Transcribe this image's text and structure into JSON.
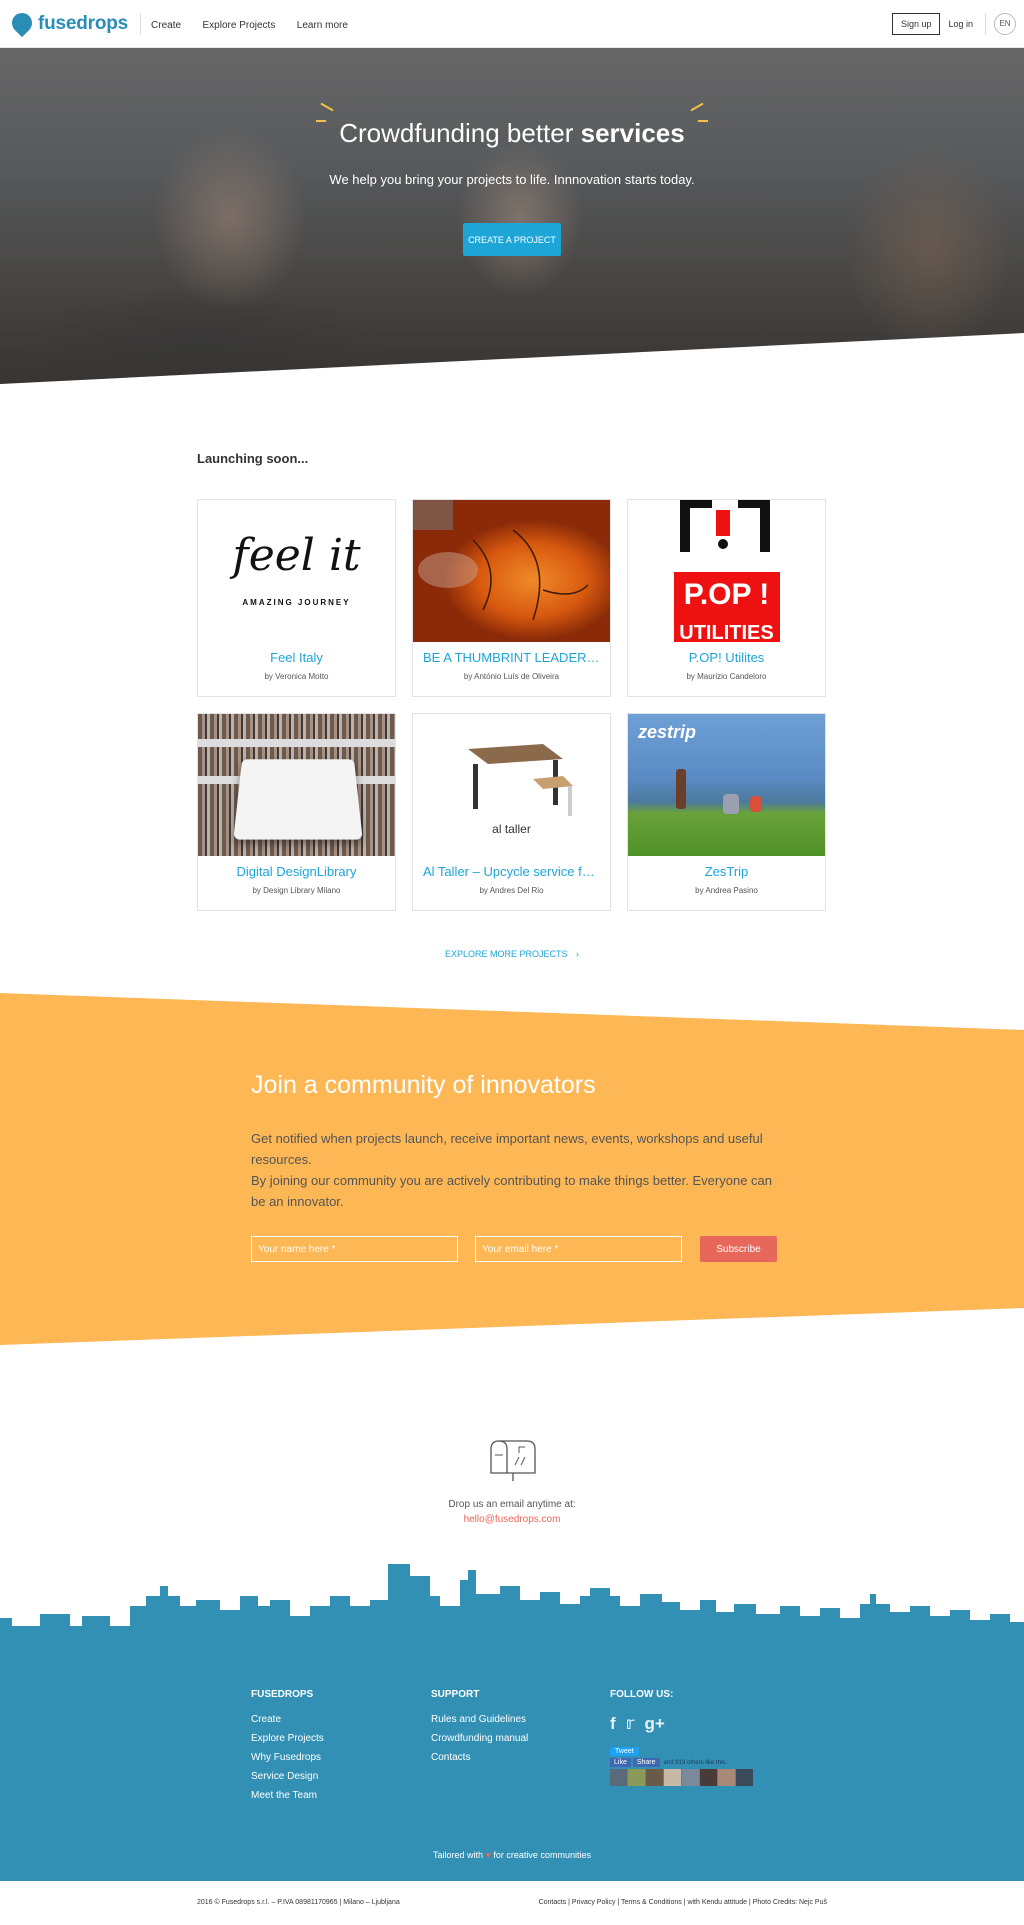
{
  "header": {
    "logo": "fusedrops",
    "nav": [
      "Create",
      "Explore Projects",
      "Learn more"
    ],
    "signup": "Sign up",
    "login": "Log in",
    "lang": "EN"
  },
  "hero": {
    "title_light": "Crowdfunding better ",
    "title_bold": "services",
    "subtitle": "We help you bring your projects to life. Innnovation starts today.",
    "cta": "CREATE A PROJECT"
  },
  "launching": {
    "title": "Launching soon...",
    "cards": [
      {
        "title": "Feel Italy",
        "author": "by Veronica Motto",
        "logo_line1": "feel it",
        "logo_line2": "AMAZING JOURNEY"
      },
      {
        "title": "BE A THUMBRINT LEADER...BE ...",
        "author": "by António Luís de Oliveira"
      },
      {
        "title": "P.OP! Utilites",
        "author": "by Maurizio Candeloro",
        "logo_line1": "P.OP !",
        "logo_line2": "UTILITIES"
      },
      {
        "title": "Digital DesignLibrary",
        "author": "by Design Library Milano"
      },
      {
        "title": "Al Taller – Upcycle service for f...",
        "author": "by Andres Del Rio",
        "logo_line1": "al taller"
      },
      {
        "title": "ZesTrip",
        "author": "by Andrea Pasino",
        "logo_line1": "zestrip"
      }
    ],
    "explore": "EXPLORE MORE PROJECTS"
  },
  "community": {
    "title": "Join a community of innovators",
    "text1": "Get notified when projects launch, receive important news, events, workshops and useful resources.",
    "text2": "By joining our community you are actively contributing to make things better. Everyone can be an innovator.",
    "name_placeholder": "Your name here *",
    "email_placeholder": "Your email here *",
    "subscribe": "Subscribe"
  },
  "contact": {
    "label": "Drop us an email anytime at:",
    "email": "hello@fusedrops.com"
  },
  "footer": {
    "col1": {
      "title": "FUSEDROPS",
      "links": [
        "Create",
        "Explore Projects",
        "Why Fusedrops",
        "Service Design",
        "Meet the Team"
      ]
    },
    "col2": {
      "title": "SUPPORT",
      "links": [
        "Rules and Guidelines",
        "Crowdfunding manual",
        "Contacts"
      ]
    },
    "col3": {
      "title": "FOLLOW US:",
      "tweet": "Tweet",
      "like": "Like",
      "share": "Share",
      "fb_text": "and 919 others like this."
    },
    "tailored_pre": "Tailored with",
    "tailored_post": "for creative communities",
    "copyright": "2016 © Fusedrops s.r.l. – P.IVA 08981170965  |  Milano – Ljubljana",
    "legal": "Contacts  |  Privacy Policy  |  Terms & Conditions  |  with Kendu attitude  |  Photo Credits: Nejc Puš"
  },
  "colors": {
    "brand": "#2a8db5",
    "accent": "#1ea5d8",
    "orange": "#fdb755",
    "coral": "#e8675b",
    "footer": "#3290b4"
  }
}
